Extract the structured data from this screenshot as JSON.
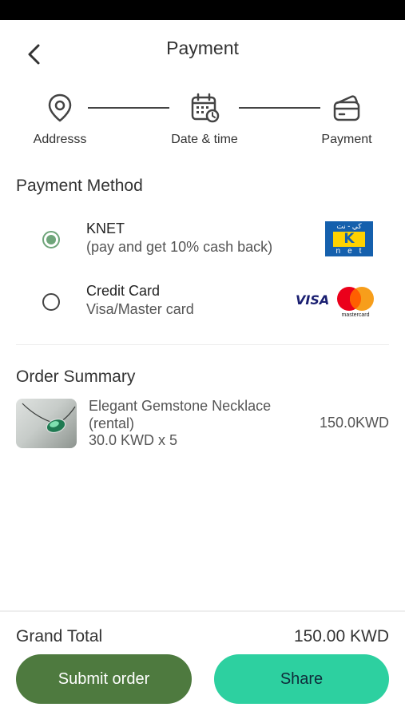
{
  "header": {
    "title": "Payment"
  },
  "steps": [
    {
      "label": "Addresss",
      "icon": "location-pin-icon"
    },
    {
      "label": "Date & time",
      "icon": "calendar-clock-icon"
    },
    {
      "label": "Payment",
      "icon": "wallet-icon"
    }
  ],
  "payment": {
    "section_title": "Payment Method",
    "options": [
      {
        "title": "KNET",
        "subtitle": "(pay and get 10% cash back)",
        "selected": true,
        "logo": {
          "top_text": "كي - نت",
          "letter": "K",
          "bottom_text": "net"
        }
      },
      {
        "title": "Credit Card",
        "subtitle": "Visa/Master card",
        "selected": false,
        "logos": {
          "visa": "VISA",
          "mastercard": "mastercard"
        }
      }
    ]
  },
  "order": {
    "section_title": "Order Summary",
    "items": [
      {
        "name": "Elegant Gemstone Necklace (rental)",
        "qty_text": "30.0 KWD x 5",
        "price": "150.0KWD"
      }
    ]
  },
  "footer": {
    "grand_total_label": "Grand Total",
    "grand_total_value": "150.00 KWD",
    "submit_label": "Submit order",
    "share_label": "Share"
  },
  "colors": {
    "primary_green": "#4e7a3f",
    "accent_teal": "#2dd0a0",
    "radio_selected": "#6fa57a",
    "knet_blue": "#1560ad",
    "knet_yellow": "#ffd200"
  }
}
